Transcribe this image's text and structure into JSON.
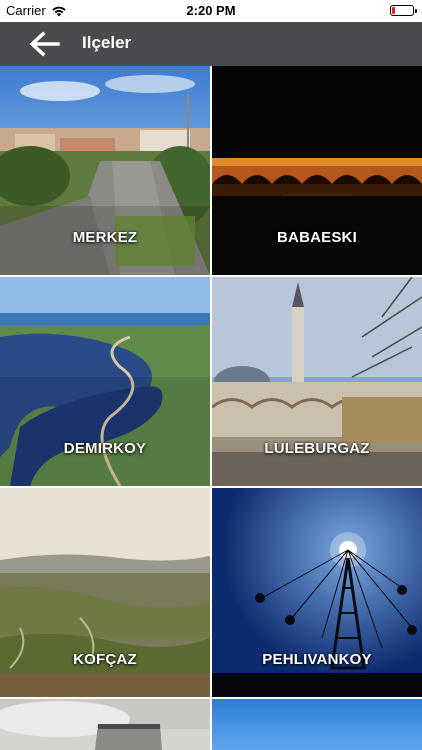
{
  "status_bar": {
    "carrier": "Carrier",
    "time": "2:20 PM",
    "battery_color": "#e02020"
  },
  "nav": {
    "title": "Ilçeler",
    "back_icon": "arrow-left-icon",
    "background": "#4a4b4e"
  },
  "districts": [
    {
      "name": "MERKEZ"
    },
    {
      "name": "BABAESKI"
    },
    {
      "name": "DEMIRKOY"
    },
    {
      "name": "LULEBURGAZ"
    },
    {
      "name": "KOFÇAZ"
    },
    {
      "name": "PEHLIVANKOY"
    },
    {
      "name": ""
    },
    {
      "name": ""
    }
  ]
}
